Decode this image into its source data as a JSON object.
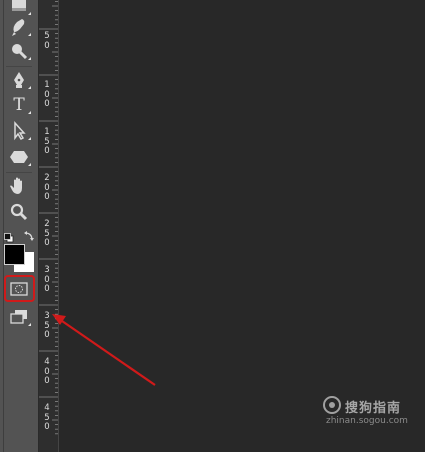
{
  "toolbar": {
    "tools": [
      {
        "name": "eraser-tool",
        "icon": "eraser-icon"
      },
      {
        "name": "brush-tool",
        "icon": "brush-icon"
      },
      {
        "name": "dodge-tool",
        "icon": "dodge-icon"
      },
      {
        "name": "pen-tool",
        "icon": "pen-icon"
      },
      {
        "name": "type-tool",
        "icon": "type-icon",
        "glyph": "T"
      },
      {
        "name": "path-selection-tool",
        "icon": "arrow-icon"
      },
      {
        "name": "shape-tool",
        "icon": "hexagon-icon"
      },
      {
        "name": "hand-tool",
        "icon": "hand-icon"
      },
      {
        "name": "zoom-tool",
        "icon": "zoom-icon"
      },
      {
        "name": "quick-mask-mode",
        "icon": "quick-mask-icon"
      },
      {
        "name": "screen-mode",
        "icon": "screen-mode-icon"
      }
    ],
    "foreground_color": "#000000",
    "background_color": "#ffffff"
  },
  "ruler": {
    "labels": [
      "5\n0",
      "1\n0\n0",
      "1\n5\n0",
      "2\n0\n0",
      "2\n5\n0",
      "3\n0\n0",
      "3\n5\n0",
      "4\n0\n0",
      "4\n5\n0"
    ]
  },
  "annotation": {
    "highlight_color": "#d01a1a",
    "arrow_color": "#d01a1a"
  },
  "watermark": {
    "brand": "搜狗指南",
    "url": "zhinan.sogou.com"
  }
}
